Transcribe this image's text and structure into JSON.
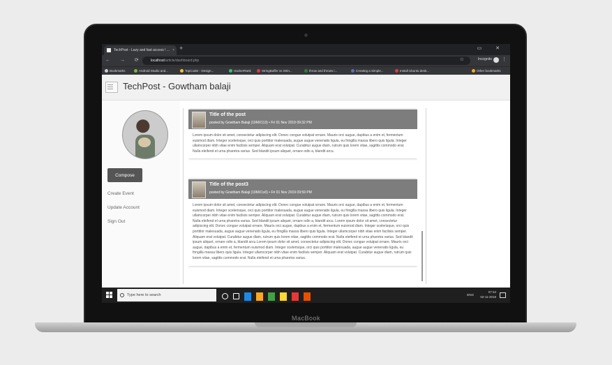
{
  "browser": {
    "tab_title": "TechPost - Lazy and fast access ! ...",
    "tab_close": "×",
    "new_tab": "+",
    "window_controls": "▭ ✕",
    "nav_buttons": "← → ⟳ ⌂",
    "url_host": "localhost",
    "url_path": "/article/dashboard.php",
    "incognito_label": "Incognito",
    "star": "☆",
    "menu": "⋮",
    "bookmarks": [
      {
        "label": "Bookmarks",
        "color": "#cccccc"
      },
      {
        "label": "Android Studio and...",
        "color": "#7cb342"
      },
      {
        "label": "TopCoder - Design...",
        "color": "#fbc02d"
      },
      {
        "label": "HackerRank",
        "color": "#2ec866"
      },
      {
        "label": "StringBuffer vs Strin...",
        "color": "#e53935"
      },
      {
        "label": "throw and throws i...",
        "color": "#2e7d32"
      },
      {
        "label": "Creating a Simple...",
        "color": "#5c6bc0"
      },
      {
        "label": "Install Ubuntu desk...",
        "color": "#e53935"
      },
      {
        "label": "Other bookmarks",
        "color": "#f9a825"
      }
    ]
  },
  "app": {
    "title": "TechPost - Gowtham balaji"
  },
  "sidebar": {
    "compose_label": "Compose",
    "links": [
      "Create Event",
      "Update Account",
      "Sign Out"
    ]
  },
  "posts": [
    {
      "title": "Title of the post",
      "meta": "posted by Gowtham Balaji (19MX113) • Fri 01 Nov 2019 09:32 PM",
      "body": "Lorem ipsum dolor sit amet, consectetur adipiscing elit. Donec congue volutpat ornare. Mauris orci augue, dapibus a enim et, fermentum euismod diam. Integer scelerisque, orci quis porttitor malesuada, augue augue venenatis ligula, eu fringilla massa libero quis ligula. Integer ullamcorper nibh vitae enim facilisis semper. Aliquam erat volutpat. Curabitur augue diam, rutrum quis lorem vitae, sagittis commodo erat. Nulla eleifend et urna pharetra varius. Sed blandit ipsum aliquet, ornare odio a, blandit arcu."
    },
    {
      "title": "Title of the post3",
      "meta": "posted by Gowtham Balaji (19MX1x0) • Fri 01 Nov 2019 09:59 PM",
      "body": "Lorem ipsum dolor sit amet, consectetur adipiscing elit. Donec congue volutpat ornare. Mauris orci augue, dapibus a enim et, fermentum euismod diam. Integer scelerisque, orci quis porttitor malesuada, augue augue venenatis ligula, eu fringilla massa libero quis ligula. Integer ullamcorper nibh vitae enim facilisis semper. Aliquam erat volutpat. Curabitur augue diam, rutrum quis lorem vitae, sagittis commodo erat. Nulla eleifend et urna pharetra varius. Sed blandit ipsum aliquet, ornare odio a, blandit arcu. Lorem ipsum dolor sit amet, consectetur adipiscing elit. Donec congue volutpat ornare. Mauris orci augue, dapibus a enim et, fermentum euismod diam. Integer scelerisque, orci quis porttitor malesuada, augue augue venenatis ligula, eu fringilla massa libero quis ligula. Integer ullamcorper nibh vitae enim facilisis semper. Aliquam erat volutpat. Curabitur augue diam, rutrum quis lorem vitae, sagittis commodo erat. Nulla eleifend et urna pharetra varius. Sed blandit ipsum aliquet, ornare odio a, blandit arcu.Lorem ipsum dolor sit amet, consectetur adipiscing elit. Donec congue volutpat ornare. Mauris orci augue, dapibus a enim et, fermentum euismod diam. Integer scelerisque, orci quis porttitor malesuada, augue augue venenatis ligula, eu fringilla massa libero quis ligula. Integer ullamcorper nibh vitae enim facilisis semper. Aliquam erat volutpat. Curabitur augue diam, rutrum quis lorem vitae, sagittis commodo erat. Nulla eleifend et urna pharetra varius."
    }
  ],
  "taskbar": {
    "search_placeholder": "Type here to search",
    "language": "ENG",
    "time": "07:34",
    "date": "02-11-2019",
    "icon_colors": [
      "#ffffff",
      "#ffffff",
      "#1e88e5",
      "#f9a825",
      "#43a047",
      "#fdd835",
      "#e53935",
      "#e65100"
    ]
  },
  "device": {
    "brand": "MacBook"
  }
}
